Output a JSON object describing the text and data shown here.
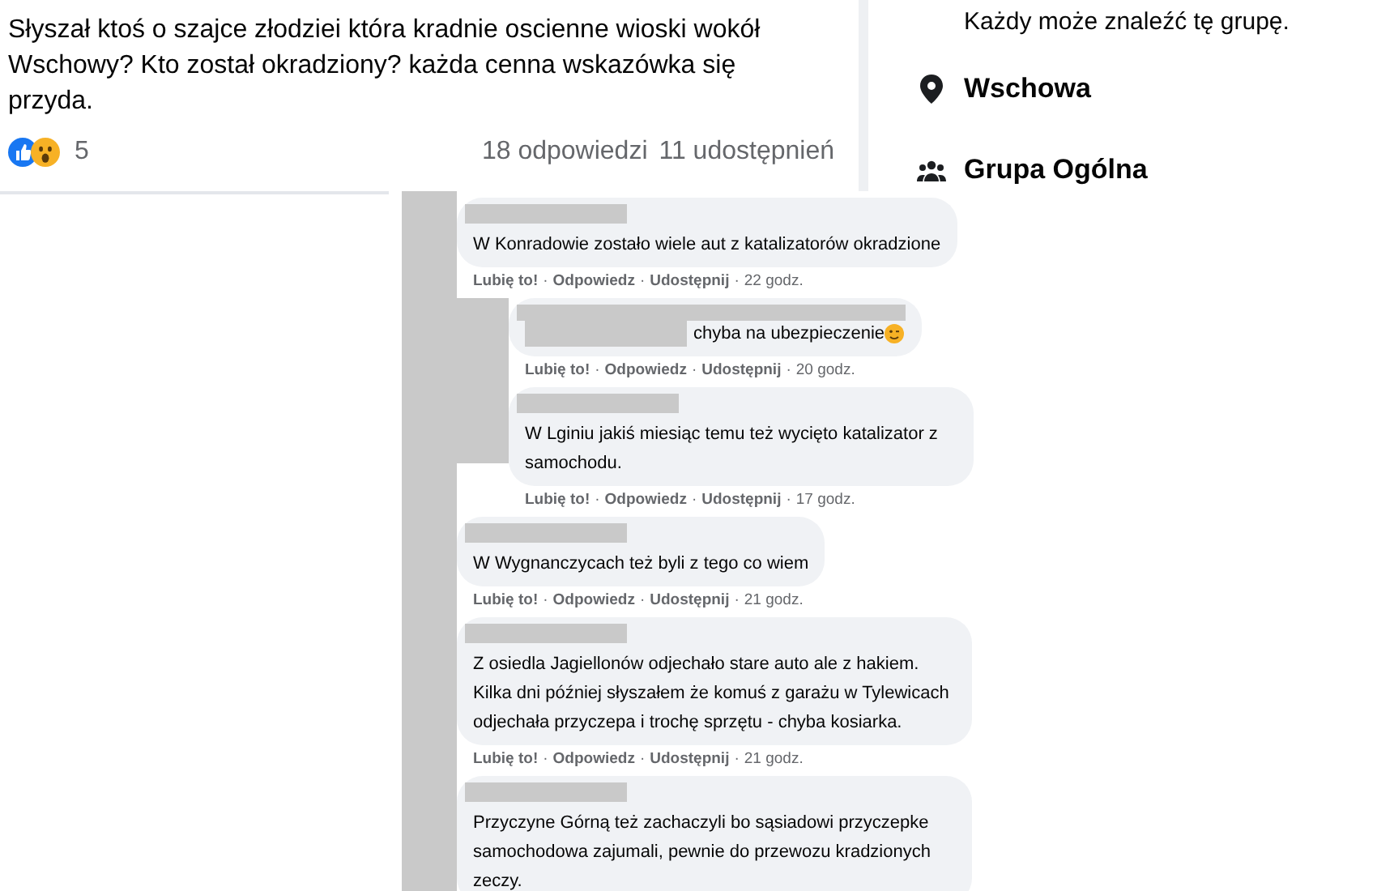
{
  "post": {
    "text": "Słyszał ktoś o szajce złodziei która kradnie oscienne wioski wokół Wschowy? Kto został okradziony? każda cenna wskazówka się przyda.",
    "reaction_count": "5",
    "comments_count": "18 odpowiedzi",
    "shares_count": "11 udostępnień"
  },
  "group_info": {
    "visibility_text": "Każdy może znaleźć tę grupę.",
    "items": [
      {
        "kind": "location",
        "label": "Wschowa"
      },
      {
        "kind": "group_type",
        "label": "Grupa Ogólna"
      }
    ]
  },
  "separator": "·",
  "comments": [
    {
      "kind": "plain",
      "text": "W Konradowie zostało wiele aut z katalizatorów okradzione",
      "actions": [
        "Lubię to!",
        "Odpowiedz",
        "Udostępnij"
      ],
      "time": "22 godz.",
      "children": [
        {
          "kind": "mention_wink",
          "text": "chyba na ubezpieczenie",
          "actions": [
            "Lubię to!",
            "Odpowiedz",
            "Udostępnij"
          ],
          "time": "20 godz."
        },
        {
          "kind": "plain",
          "text": "W Lginiu jakiś miesiąc temu też wycięto katalizator z samochodu.",
          "actions": [
            "Lubię to!",
            "Odpowiedz",
            "Udostępnij"
          ],
          "time": "17 godz."
        }
      ]
    },
    {
      "kind": "plain",
      "text": "W Wygnanczycach też byli z tego co wiem",
      "actions": [
        "Lubię to!",
        "Odpowiedz",
        "Udostępnij"
      ],
      "time": "21 godz."
    },
    {
      "kind": "plain",
      "text": "Z osiedla Jagiellonów odjechało stare auto ale z hakiem. Kilka dni później słyszałem że komuś z garażu w Tylewicach odjechała przyczepa i trochę sprzętu - chyba kosiarka.",
      "actions": [
        "Lubię to!",
        "Odpowiedz",
        "Udostępnij"
      ],
      "time": "21 godz."
    },
    {
      "kind": "plain",
      "text": "Przyczyne Górną też zachaczyli bo sąsiadowi przyczepke samochodowa zajumali, pewnie do przewozu kradzionych zeczy."
    }
  ]
}
